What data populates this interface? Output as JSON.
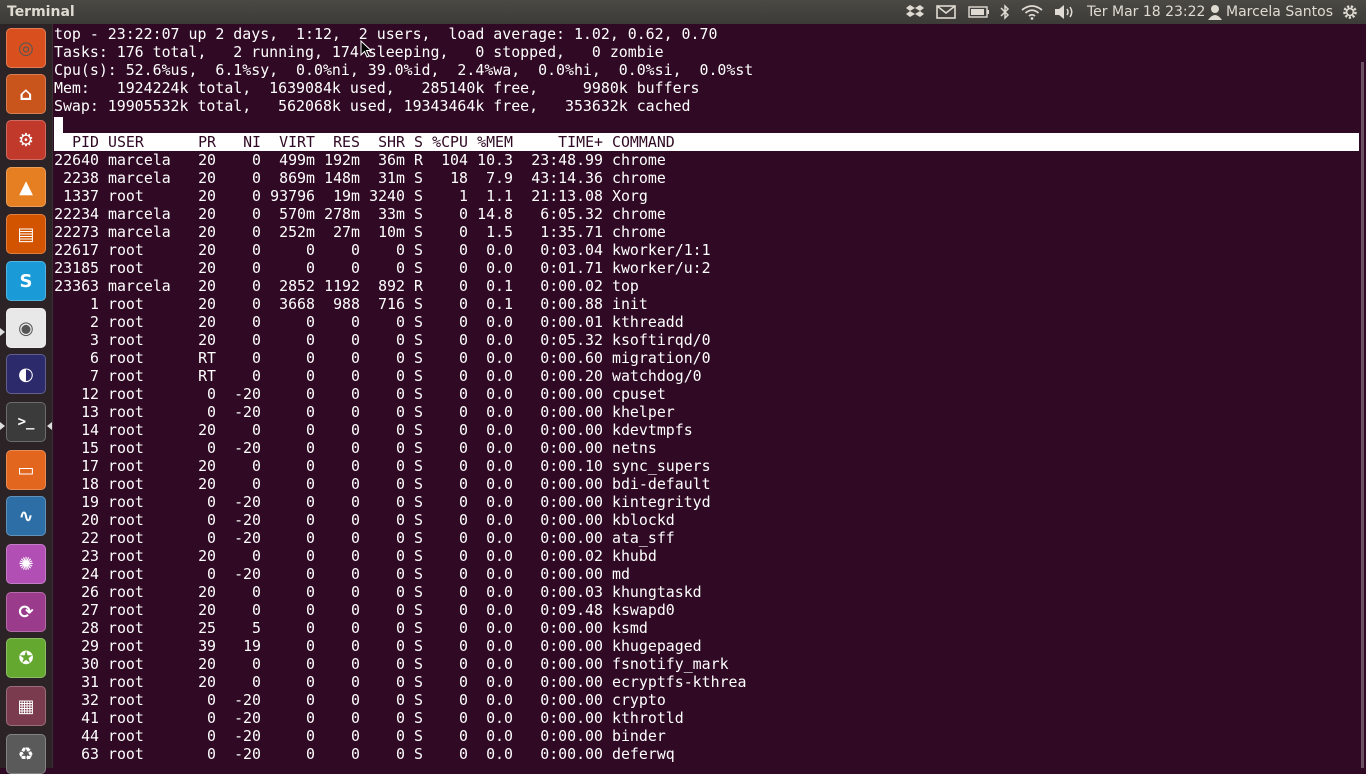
{
  "panel": {
    "app_title": "Terminal",
    "clock": "Ter Mar 18 23:22",
    "user": "Marcela Santos",
    "indicators": [
      "dropbox-icon",
      "mail-icon",
      "battery-icon",
      "bluetooth-icon",
      "wifi-icon",
      "volume-icon"
    ]
  },
  "launcher": [
    {
      "name": "dash-home",
      "color": "#d9501e"
    },
    {
      "name": "software-center",
      "color": "#c9541c"
    },
    {
      "name": "system-settings",
      "color": "#c0392b"
    },
    {
      "name": "vlc",
      "color": "#e67e22"
    },
    {
      "name": "libreoffice-impress",
      "color": "#d35400"
    },
    {
      "name": "skype",
      "color": "#1a9bd7"
    },
    {
      "name": "chrome",
      "color": "#e8e8e8"
    },
    {
      "name": "eclipse",
      "color": "#2c2a6b"
    },
    {
      "name": "terminal",
      "color": "#3b3b3b"
    },
    {
      "name": "files",
      "color": "#e2661d"
    },
    {
      "name": "system-monitor",
      "color": "#2e6ea6"
    },
    {
      "name": "picasa",
      "color": "#b14fb4"
    },
    {
      "name": "synaptic",
      "color": "#9b3b8b"
    },
    {
      "name": "update-manager",
      "color": "#65a830"
    },
    {
      "name": "workspace-switcher",
      "color": "#7a3b4e"
    },
    {
      "name": "trash",
      "color": "#5a5a5a"
    }
  ],
  "top": {
    "summary": [
      "top - 23:22:07 up 2 days,  1:12,  2 users,  load average: 1.02, 0.62, 0.70",
      "Tasks: 176 total,   2 running, 174 sleeping,   0 stopped,   0 zombie",
      "Cpu(s): 52.6%us,  6.1%sy,  0.0%ni, 39.0%id,  2.4%wa,  0.0%hi,  0.0%si,  0.0%st",
      "Mem:   1924224k total,  1639084k used,   285140k free,     9980k buffers",
      "Swap: 19905532k total,   562068k used, 19343464k free,   353632k cached"
    ],
    "columns": [
      "PID",
      "USER",
      "PR",
      "NI",
      "VIRT",
      "RES",
      "SHR",
      "S",
      "%CPU",
      "%MEM",
      "TIME+",
      "COMMAND"
    ],
    "processes": [
      [
        "22640",
        "marcela",
        "20",
        "0",
        "499m",
        "192m",
        "36m",
        "R",
        "104",
        "10.3",
        "23:48.99",
        "chrome"
      ],
      [
        "2238",
        "marcela",
        "20",
        "0",
        "869m",
        "148m",
        "31m",
        "S",
        "18",
        "7.9",
        "43:14.36",
        "chrome"
      ],
      [
        "1337",
        "root",
        "20",
        "0",
        "93796",
        "19m",
        "3240",
        "S",
        "1",
        "1.1",
        "21:13.08",
        "Xorg"
      ],
      [
        "22234",
        "marcela",
        "20",
        "0",
        "570m",
        "278m",
        "33m",
        "S",
        "0",
        "14.8",
        "6:05.32",
        "chrome"
      ],
      [
        "22273",
        "marcela",
        "20",
        "0",
        "252m",
        "27m",
        "10m",
        "S",
        "0",
        "1.5",
        "1:35.71",
        "chrome"
      ],
      [
        "22617",
        "root",
        "20",
        "0",
        "0",
        "0",
        "0",
        "S",
        "0",
        "0.0",
        "0:03.04",
        "kworker/1:1"
      ],
      [
        "23185",
        "root",
        "20",
        "0",
        "0",
        "0",
        "0",
        "S",
        "0",
        "0.0",
        "0:01.71",
        "kworker/u:2"
      ],
      [
        "23363",
        "marcela",
        "20",
        "0",
        "2852",
        "1192",
        "892",
        "R",
        "0",
        "0.1",
        "0:00.02",
        "top"
      ],
      [
        "1",
        "root",
        "20",
        "0",
        "3668",
        "988",
        "716",
        "S",
        "0",
        "0.1",
        "0:00.88",
        "init"
      ],
      [
        "2",
        "root",
        "20",
        "0",
        "0",
        "0",
        "0",
        "S",
        "0",
        "0.0",
        "0:00.01",
        "kthreadd"
      ],
      [
        "3",
        "root",
        "20",
        "0",
        "0",
        "0",
        "0",
        "S",
        "0",
        "0.0",
        "0:05.32",
        "ksoftirqd/0"
      ],
      [
        "6",
        "root",
        "RT",
        "0",
        "0",
        "0",
        "0",
        "S",
        "0",
        "0.0",
        "0:00.60",
        "migration/0"
      ],
      [
        "7",
        "root",
        "RT",
        "0",
        "0",
        "0",
        "0",
        "S",
        "0",
        "0.0",
        "0:00.20",
        "watchdog/0"
      ],
      [
        "12",
        "root",
        "0",
        "-20",
        "0",
        "0",
        "0",
        "S",
        "0",
        "0.0",
        "0:00.00",
        "cpuset"
      ],
      [
        "13",
        "root",
        "0",
        "-20",
        "0",
        "0",
        "0",
        "S",
        "0",
        "0.0",
        "0:00.00",
        "khelper"
      ],
      [
        "14",
        "root",
        "20",
        "0",
        "0",
        "0",
        "0",
        "S",
        "0",
        "0.0",
        "0:00.00",
        "kdevtmpfs"
      ],
      [
        "15",
        "root",
        "0",
        "-20",
        "0",
        "0",
        "0",
        "S",
        "0",
        "0.0",
        "0:00.00",
        "netns"
      ],
      [
        "17",
        "root",
        "20",
        "0",
        "0",
        "0",
        "0",
        "S",
        "0",
        "0.0",
        "0:00.10",
        "sync_supers"
      ],
      [
        "18",
        "root",
        "20",
        "0",
        "0",
        "0",
        "0",
        "S",
        "0",
        "0.0",
        "0:00.00",
        "bdi-default"
      ],
      [
        "19",
        "root",
        "0",
        "-20",
        "0",
        "0",
        "0",
        "S",
        "0",
        "0.0",
        "0:00.00",
        "kintegrityd"
      ],
      [
        "20",
        "root",
        "0",
        "-20",
        "0",
        "0",
        "0",
        "S",
        "0",
        "0.0",
        "0:00.00",
        "kblockd"
      ],
      [
        "22",
        "root",
        "0",
        "-20",
        "0",
        "0",
        "0",
        "S",
        "0",
        "0.0",
        "0:00.00",
        "ata_sff"
      ],
      [
        "23",
        "root",
        "20",
        "0",
        "0",
        "0",
        "0",
        "S",
        "0",
        "0.0",
        "0:00.02",
        "khubd"
      ],
      [
        "24",
        "root",
        "0",
        "-20",
        "0",
        "0",
        "0",
        "S",
        "0",
        "0.0",
        "0:00.00",
        "md"
      ],
      [
        "26",
        "root",
        "20",
        "0",
        "0",
        "0",
        "0",
        "S",
        "0",
        "0.0",
        "0:00.03",
        "khungtaskd"
      ],
      [
        "27",
        "root",
        "20",
        "0",
        "0",
        "0",
        "0",
        "S",
        "0",
        "0.0",
        "0:09.48",
        "kswapd0"
      ],
      [
        "28",
        "root",
        "25",
        "5",
        "0",
        "0",
        "0",
        "S",
        "0",
        "0.0",
        "0:00.00",
        "ksmd"
      ],
      [
        "29",
        "root",
        "39",
        "19",
        "0",
        "0",
        "0",
        "S",
        "0",
        "0.0",
        "0:00.00",
        "khugepaged"
      ],
      [
        "30",
        "root",
        "20",
        "0",
        "0",
        "0",
        "0",
        "S",
        "0",
        "0.0",
        "0:00.00",
        "fsnotify_mark"
      ],
      [
        "31",
        "root",
        "20",
        "0",
        "0",
        "0",
        "0",
        "S",
        "0",
        "0.0",
        "0:00.00",
        "ecryptfs-kthrea"
      ],
      [
        "32",
        "root",
        "0",
        "-20",
        "0",
        "0",
        "0",
        "S",
        "0",
        "0.0",
        "0:00.00",
        "crypto"
      ],
      [
        "41",
        "root",
        "0",
        "-20",
        "0",
        "0",
        "0",
        "S",
        "0",
        "0.0",
        "0:00.00",
        "kthrotld"
      ],
      [
        "44",
        "root",
        "0",
        "-20",
        "0",
        "0",
        "0",
        "S",
        "0",
        "0.0",
        "0:00.00",
        "binder"
      ],
      [
        "63",
        "root",
        "0",
        "-20",
        "0",
        "0",
        "0",
        "S",
        "0",
        "0.0",
        "0:00.00",
        "deferwq"
      ]
    ]
  }
}
